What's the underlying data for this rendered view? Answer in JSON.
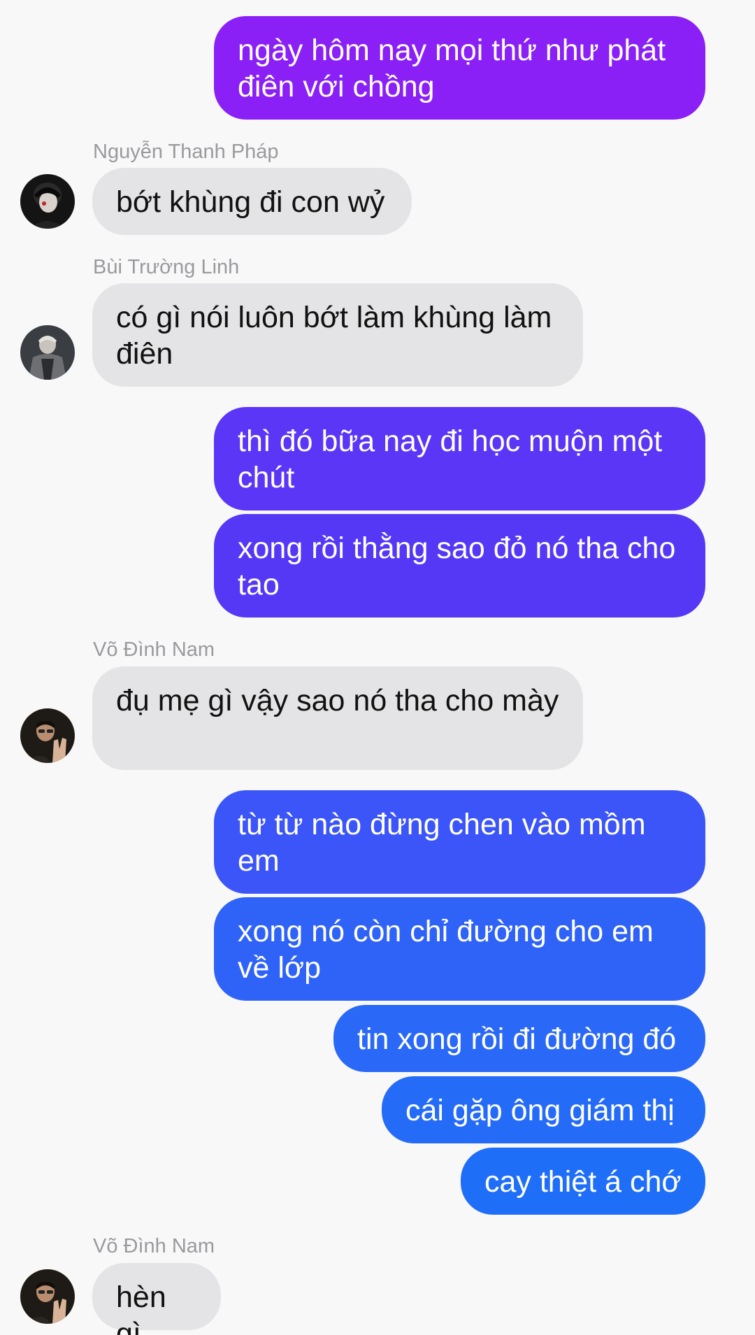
{
  "colors": {
    "out_1": "#8a20f6",
    "out_2": "#5b36f7",
    "out_3": "#3b55f8",
    "out_4": "#1f6ef8",
    "incoming": "#e4e4e6",
    "sender_name": "#9a9a9e"
  },
  "messages": [
    {
      "type": "out",
      "text": "ngày hôm nay mọi thứ như phát điên với chồng"
    },
    {
      "type": "sender",
      "text": "Nguyễn Thanh Pháp"
    },
    {
      "type": "in",
      "text": "bớt khùng đi con wỷ",
      "avatar": "avatar-thanh-phap"
    },
    {
      "type": "sender",
      "text": "Bùi Trường Linh"
    },
    {
      "type": "in",
      "text": "có gì nói luôn bớt làm khùng làm điên",
      "avatar": "avatar-truong-linh"
    },
    {
      "type": "out",
      "text": "thì đó bữa nay đi học muộn một chút"
    },
    {
      "type": "out",
      "text": "xong rồi thằng sao đỏ nó tha cho tao"
    },
    {
      "type": "sender",
      "text": "Võ Đình Nam"
    },
    {
      "type": "in",
      "text": "đụ mẹ gì vậy sao nó tha cho mày",
      "avatar": "avatar-dinh-nam"
    },
    {
      "type": "out",
      "text": "từ từ nào đừng chen vào mồm em"
    },
    {
      "type": "out",
      "text": "xong nó còn chỉ đường cho em về lớp"
    },
    {
      "type": "out",
      "text": "tin xong rồi đi đường đó"
    },
    {
      "type": "out",
      "text": "cái gặp ông giám thị"
    },
    {
      "type": "out",
      "text": "cay thiệt á chớ"
    },
    {
      "type": "sender",
      "text": "Võ Đình Nam"
    },
    {
      "type": "in",
      "text": "hèn gì",
      "avatar": "avatar-dinh-nam"
    }
  ]
}
